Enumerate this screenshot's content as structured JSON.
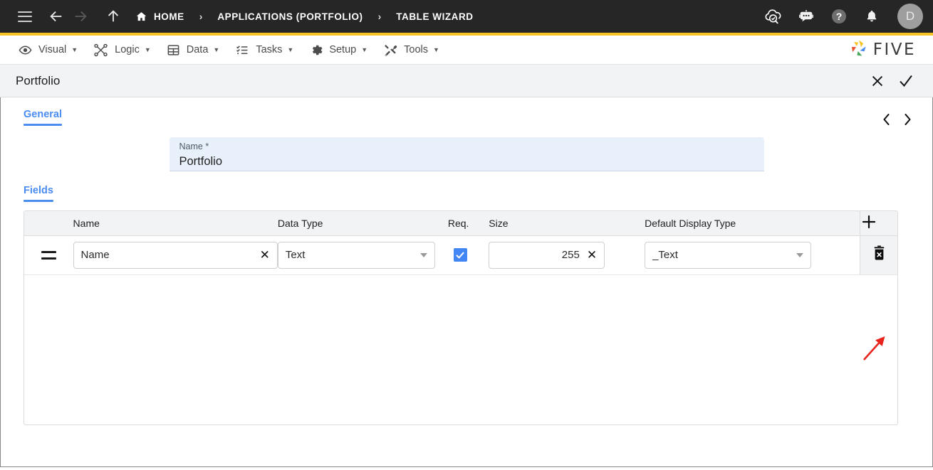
{
  "topbar": {
    "menu_icon": "hamburger-icon",
    "back_icon": "arrow-left-icon",
    "forward_icon": "arrow-right-icon",
    "up_icon": "arrow-up-icon",
    "breadcrumbs": [
      {
        "label": "HOME",
        "icon": "home-icon"
      },
      {
        "label": "APPLICATIONS (PORTFOLIO)",
        "icon": ""
      },
      {
        "label": "TABLE WIZARD",
        "icon": ""
      }
    ],
    "separator": "›",
    "actions": [
      {
        "name": "cloud-check-icon",
        "label": ""
      },
      {
        "name": "robot-icon",
        "label": ""
      },
      {
        "name": "help-icon",
        "label": ""
      },
      {
        "name": "bell-icon",
        "label": ""
      }
    ],
    "avatar_initial": "D",
    "accent_color": "#f6c324",
    "background_color": "#262626"
  },
  "menubar": {
    "items": [
      {
        "label": "Visual",
        "icon": "eye-icon",
        "caret": "▼"
      },
      {
        "label": "Logic",
        "icon": "logic-nodes-icon",
        "caret": "▼"
      },
      {
        "label": "Data",
        "icon": "table-icon",
        "caret": "▼"
      },
      {
        "label": "Tasks",
        "icon": "checklist-icon",
        "caret": "▼"
      },
      {
        "label": "Setup",
        "icon": "gear-icon",
        "caret": "▼"
      },
      {
        "label": "Tools",
        "icon": "tools-icon",
        "caret": "▼"
      }
    ],
    "brand": "FIVE"
  },
  "titlebar": {
    "title": "Portfolio",
    "close_icon": "close-icon",
    "confirm_icon": "check-icon"
  },
  "general": {
    "tab_label": "General",
    "prev_icon": "chevron-left-icon",
    "next_icon": "chevron-right-icon",
    "name_label": "Name *",
    "name_value": "Portfolio"
  },
  "fields": {
    "tab_label": "Fields",
    "columns": [
      "Name",
      "Data Type",
      "Req.",
      "Size",
      "Default Display Type"
    ],
    "add_icon": "plus-icon",
    "rows": [
      {
        "handle": "drag-handle-icon",
        "name": "Name",
        "name_clear": "✕",
        "data_type": "Text",
        "required": true,
        "size": "255",
        "size_clear": "✕",
        "default_display_type": "_Text",
        "delete_icon": "trash-icon"
      }
    ]
  },
  "annotation": {
    "arrow": "red-arrow-pointing-to-add-button",
    "color": "#e8241d"
  },
  "colors": {
    "accent_blue": "#4a8cf0",
    "checkbox_blue": "#4285f4",
    "header_grey": "#f2f3f5",
    "field_blue": "#e8f0fb"
  }
}
